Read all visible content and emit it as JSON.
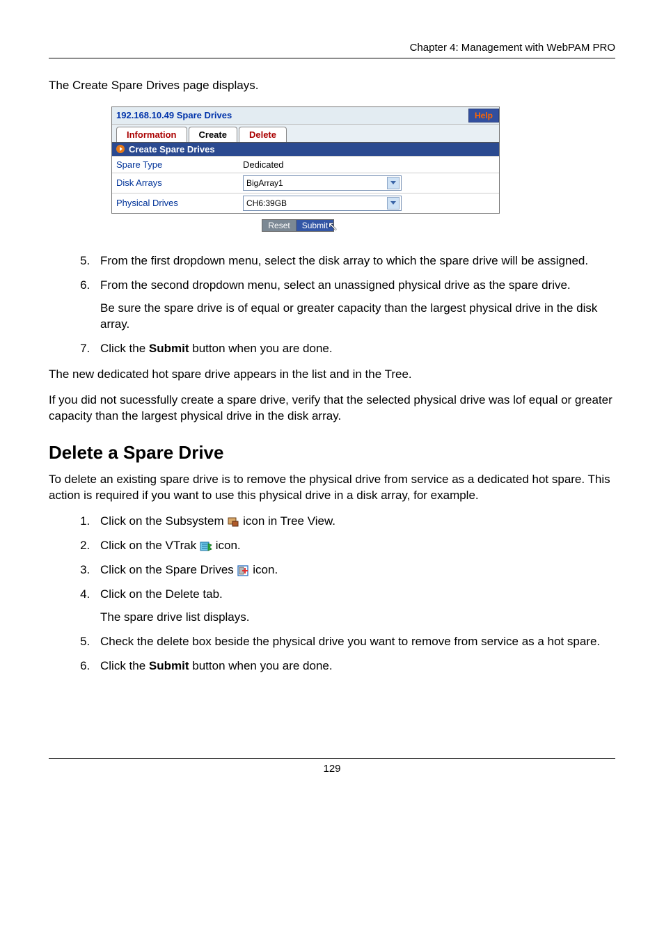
{
  "header": {
    "chapter_line": "Chapter 4: Management with WebPAM PRO"
  },
  "intro_text": "The Create Spare Drives page displays.",
  "panel": {
    "title": "192.168.10.49 Spare Drives",
    "help_label": "Help",
    "tabs": {
      "information": "Information",
      "create": "Create",
      "delete": "Delete"
    },
    "section_label": "Create Spare Drives",
    "rows": {
      "spare_type_label": "Spare Type",
      "spare_type_value": "Dedicated",
      "disk_arrays_label": "Disk Arrays",
      "disk_arrays_value": "BigArray1",
      "physical_drives_label": "Physical Drives",
      "physical_drives_value": "CH6:39GB"
    },
    "buttons": {
      "reset": "Reset",
      "submit": "Submit"
    }
  },
  "steps1": {
    "s5": "From the first dropdown menu, select the disk array to which the spare drive will be assigned.",
    "s6": "From the second dropdown menu, select an unassigned physical drive as the spare drive.",
    "s6_note": "Be sure the spare drive is of equal or greater capacity than the largest physical drive in the disk array.",
    "s7_pre": "Click the ",
    "s7_bold": "Submit",
    "s7_post": " button when you are done."
  },
  "after1": {
    "p1": "The new dedicated hot spare drive appears in the list and in the Tree.",
    "p2": "If you did not sucessfully create a spare drive, verify that the selected physical drive was lof equal or greater capacity than the largest physical drive in the disk array."
  },
  "section2": {
    "heading": "Delete a Spare Drive",
    "intro": "To delete an existing spare drive is to remove the physical drive from service as a dedicated hot spare. This action is required if you want to use this physical drive in a disk array, for example."
  },
  "steps2": {
    "s1_pre": "Click on the Subsystem ",
    "s1_post": " icon in Tree View.",
    "s2_pre": "Click on the VTrak ",
    "s2_post": " icon.",
    "s3_pre": "Click on the Spare Drives ",
    "s3_post": " icon.",
    "s4": "Click on the Delete tab.",
    "s4_note": "The spare drive list displays.",
    "s5": "Check the delete box beside the physical drive you want to remove from service as a hot spare.",
    "s6_pre": "Click the ",
    "s6_bold": "Submit",
    "s6_post": " button when you are done."
  },
  "footer": {
    "page_number": "129"
  }
}
